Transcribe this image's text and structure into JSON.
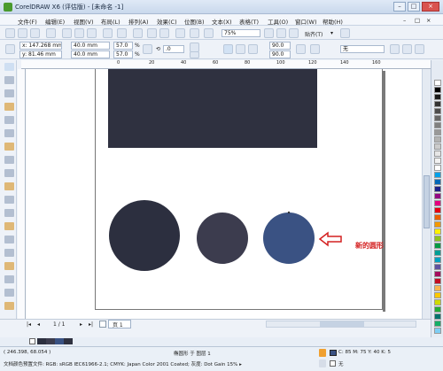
{
  "window": {
    "title": "CorelDRAW X6 (评估版) - [未命名 -1]",
    "minimize_glyph": "–",
    "maximize_glyph": "□",
    "close_glyph": "×",
    "mdi_min_glyph": "–",
    "mdi_max_glyph": "□",
    "mdi_close_glyph": "×"
  },
  "menus": [
    "文件(F)",
    "编辑(E)",
    "视图(V)",
    "布局(L)",
    "排列(A)",
    "效果(C)",
    "位图(B)",
    "文本(X)",
    "表格(T)",
    "工具(O)",
    "窗口(W)",
    "帮助(H)"
  ],
  "standard_toolbar": {
    "zoom": "75%",
    "snap_label": "贴齐(T)",
    "snap_arrow": "▾"
  },
  "property_bar": {
    "x": "x: 147.268 mm",
    "y": "y: 81.46 mm",
    "width": "40.0 mm",
    "height": "40.0 mm",
    "scale_x": "57.0",
    "scale_y": "57.0",
    "percent": "%",
    "rotation": ".0",
    "angle_start": "90.0",
    "angle_end": "90.0",
    "outline": "无"
  },
  "ruler_ticks": [
    "0",
    "20",
    "40",
    "60",
    "80",
    "100",
    "120",
    "140",
    "160"
  ],
  "canvas": {
    "rect_color": "#2f3140",
    "circles": [
      {
        "color": "#2c2f3f"
      },
      {
        "color": "#3c3c4e"
      },
      {
        "color": "#3a5283"
      }
    ],
    "annotation": "新的圆形",
    "annotation_color": "#d42020"
  },
  "page_nav": {
    "first": "|◂",
    "prev": "◂",
    "indicator": "1 / 1",
    "next": "▸",
    "last": "▸|",
    "tab": "页 1"
  },
  "status": {
    "coords": "( 246.398, 68.054 )",
    "object_info": "椭圆形 于 图层 1",
    "color_profile": "文档颜色预置文件: RGB: sRGB IEC61966-2.1; CMYK: Japan Color 2001 Coated; 灰度: Dot Gain 15% ▸",
    "fill_info": "C: 85 M: 75 Y: 40 K: 5",
    "outline_info": "无"
  },
  "palette": [
    "#ffffff",
    "#000000",
    "#1a1a1a",
    "#333333",
    "#4d4d4d",
    "#666666",
    "#808080",
    "#999999",
    "#b3b3b3",
    "#cccccc",
    "#e6e6e6",
    "#f2f2f2",
    "#ffffff",
    "#00a0e9",
    "#0068b7",
    "#1d2088",
    "#920783",
    "#e4007f",
    "#e60012",
    "#eb6100",
    "#f39800",
    "#fff100",
    "#8fc31f",
    "#009944",
    "#009e96",
    "#00a0c1",
    "#5f52a0",
    "#a40b5d",
    "#c30d23",
    "#f8b551",
    "#fcc800",
    "#cfdb00",
    "#22ac38",
    "#00736d",
    "#13ae67",
    "#7ecef4"
  ],
  "tools": [
    "pick-tool",
    "shape-tool",
    "crop-tool",
    "zoom-tool",
    "freehand-tool",
    "smart-fill-tool",
    "rectangle-tool",
    "ellipse-tool",
    "polygon-tool",
    "text-tool",
    "table-tool",
    "dimension-tool",
    "connector-tool",
    "blend-tool",
    "transparency-tool",
    "eyedropper-tool",
    "outline-tool",
    "fill-tool",
    "interactive-fill-tool"
  ]
}
